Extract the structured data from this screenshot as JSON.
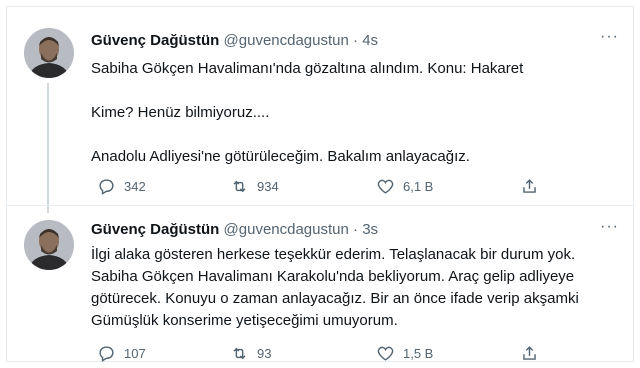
{
  "tweets": [
    {
      "author_name": "Güvenç Dağüstün",
      "handle": "@guvencdagustun",
      "separator": "·",
      "time": "4s",
      "more_icon": "···",
      "lines": [
        "Sabiha Gökçen Havalimanı'nda gözaltına alındım. Konu: Hakaret",
        "Kime? Henüz bilmiyoruz....",
        "Anadolu Adliyesi'ne götürüleceğim. Bakalım anlayacağız."
      ],
      "replies": "342",
      "retweets": "934",
      "likes": "6,1 B"
    },
    {
      "author_name": "Güvenç Dağüstün",
      "handle": "@guvencdagustun",
      "separator": "·",
      "time": "3s",
      "more_icon": "···",
      "lines": [
        "İlgi alaka gösteren herkese teşekkür ederim. Telaşlanacak bir durum yok.",
        "Sabiha Gökçen Havalimanı Karakolu'nda bekliyorum. Araç gelip adliyeye",
        "götürecek. Konuyu o zaman anlayacağız. Bir an önce ifade verip akşamki",
        "Gümüşlük konserime yetişeceğimi umuyorum."
      ],
      "replies": "107",
      "retweets": "93",
      "likes": "1,5 B"
    }
  ],
  "colors": {
    "text": "#0f1419",
    "muted": "#536471",
    "border": "#e6ecf0",
    "thread": "#cfd9de"
  },
  "icons": [
    "reply-icon",
    "retweet-icon",
    "like-icon",
    "share-icon",
    "more-icon"
  ]
}
